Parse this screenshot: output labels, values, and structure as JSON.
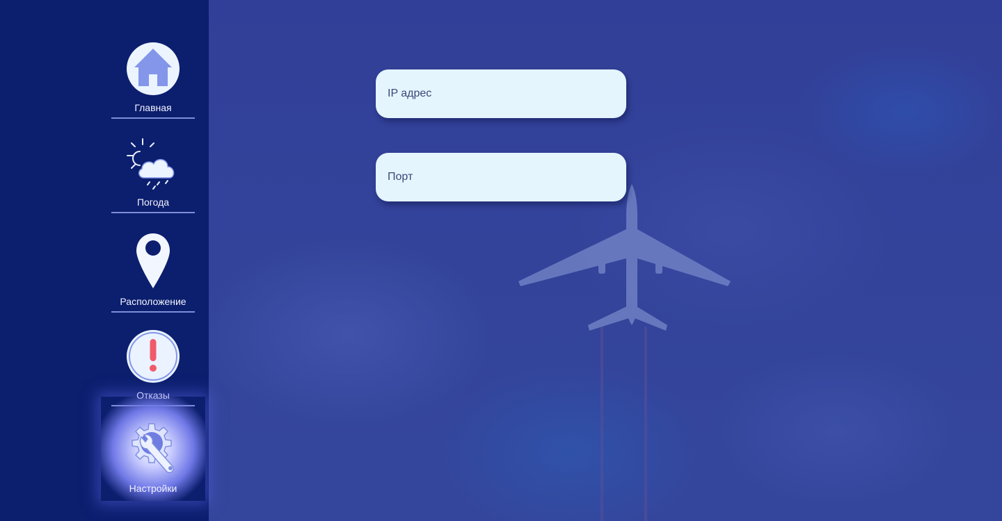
{
  "sidebar": {
    "items": [
      {
        "label": "Главная",
        "icon": "home-icon",
        "active": false
      },
      {
        "label": "Погода",
        "icon": "weather-icon",
        "active": false
      },
      {
        "label": "Расположение",
        "icon": "location-pin-icon",
        "active": false
      },
      {
        "label": "Отказы",
        "icon": "alert-icon",
        "active": false
      },
      {
        "label": "Настройки",
        "icon": "settings-wrench-gear-icon",
        "active": true
      }
    ]
  },
  "main": {
    "ip_field": {
      "placeholder": "IP адрес",
      "value": ""
    },
    "port_field": {
      "placeholder": "Порт",
      "value": ""
    }
  },
  "colors": {
    "sidebar_bg": "#0c1e6e",
    "content_bg": "#323f98",
    "field_bg": "#e4f5fd",
    "icon_fill": "#8093e8",
    "alert_red": "#f05a6a",
    "divider": "#7e8fd8"
  }
}
